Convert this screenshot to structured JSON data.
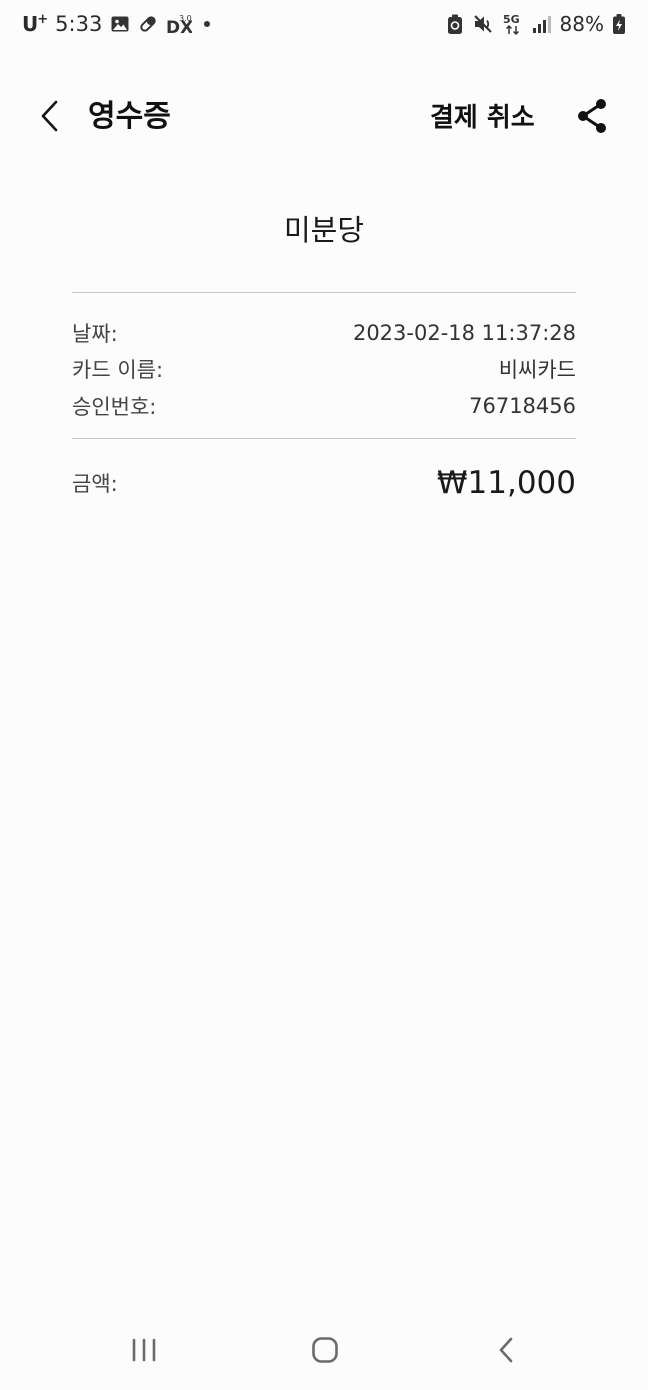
{
  "status_bar": {
    "carrier": "U",
    "carrier_sup": "+",
    "time": "5:33",
    "battery": "88%",
    "icons_left": [
      "image-icon",
      "pill-icon",
      "dex-icon"
    ],
    "icons_right": [
      "battery-saver-icon",
      "mute-icon",
      "5g-icon",
      "signal-icon",
      "battery-charging-icon"
    ]
  },
  "app_bar": {
    "title": "영수증",
    "cancel_label": "결제 취소",
    "back_icon": "chevron-left-icon",
    "share_icon": "share-icon"
  },
  "receipt": {
    "merchant": "미분당",
    "details": [
      {
        "label": "날짜:",
        "value": "2023-02-18 11:37:28"
      },
      {
        "label": "카드 이름:",
        "value": "비씨카드"
      },
      {
        "label": "승인번호:",
        "value": "76718456"
      }
    ],
    "amount": {
      "label": "금액:",
      "value": "₩11,000"
    }
  },
  "nav_bar": {
    "icons": [
      "recents-icon",
      "home-icon",
      "back-icon"
    ]
  }
}
